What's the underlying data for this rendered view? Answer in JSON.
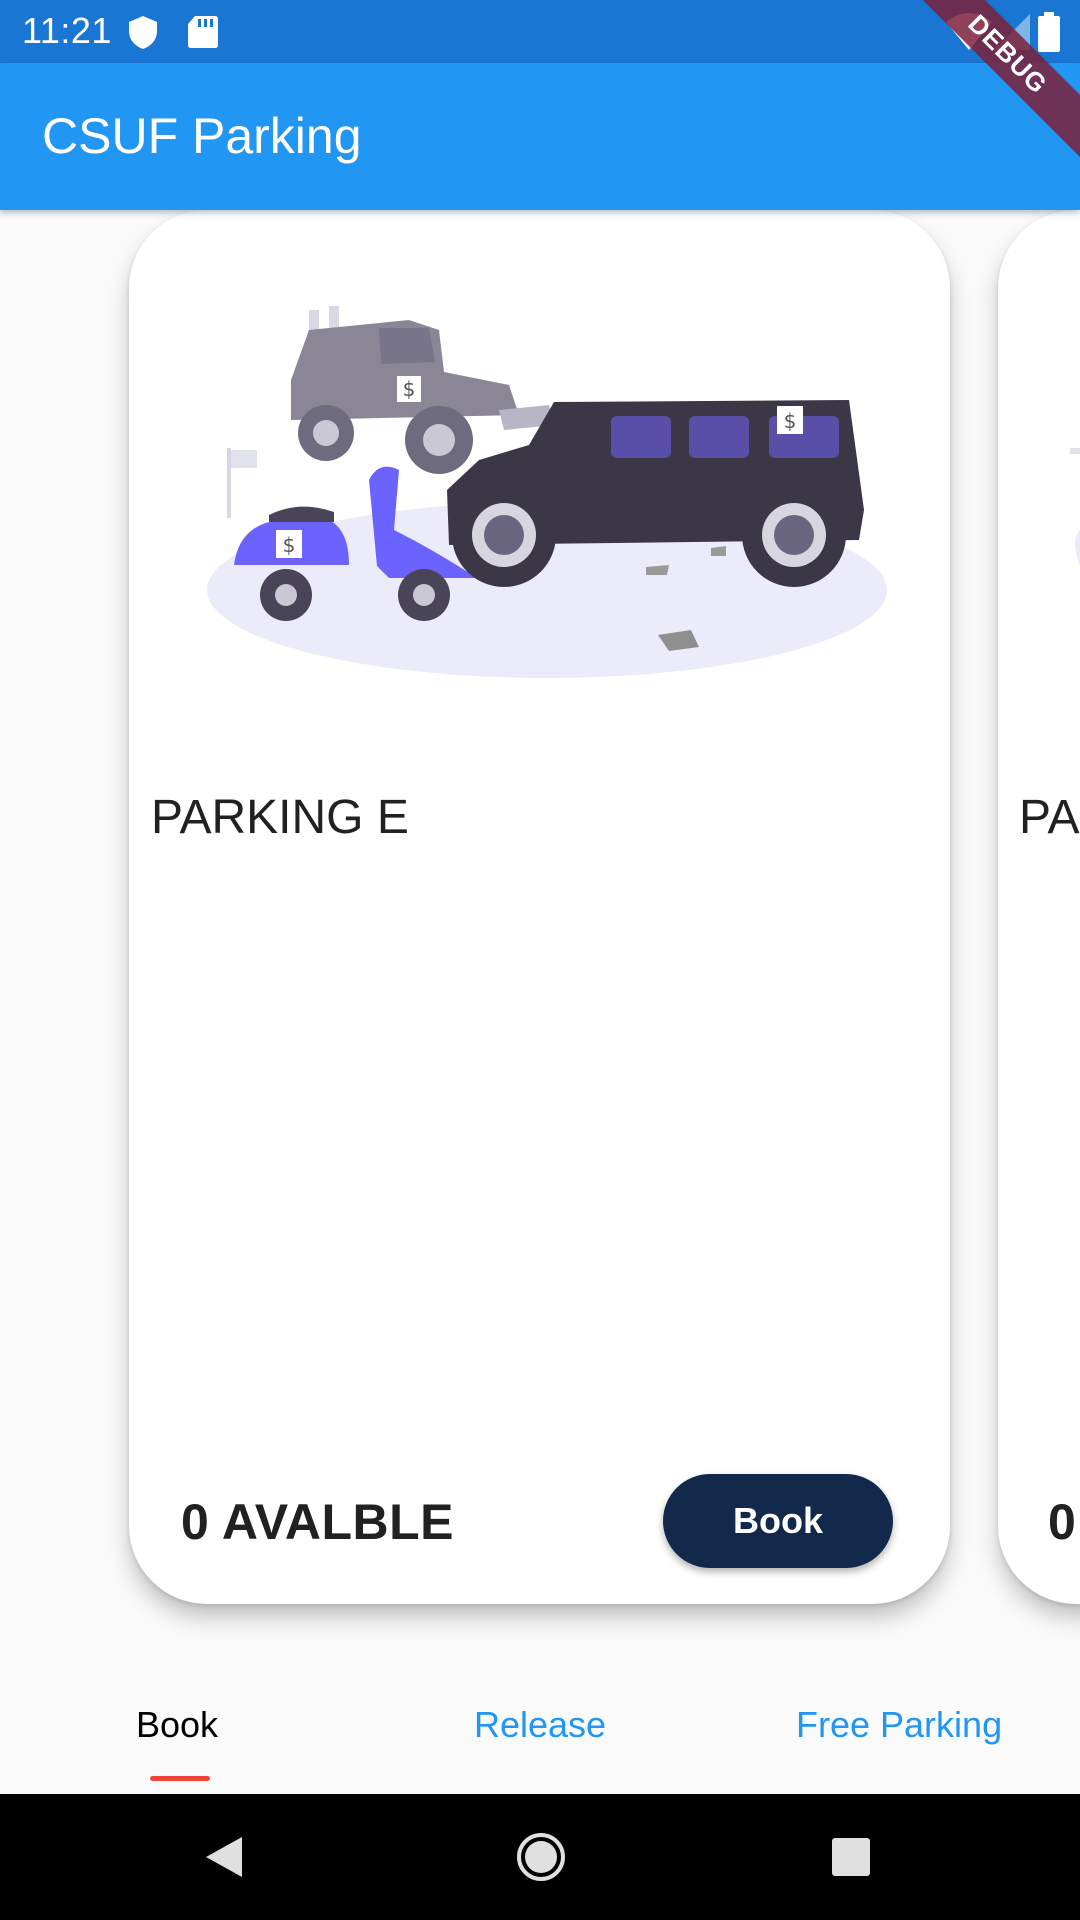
{
  "status_bar": {
    "time": "11:21",
    "icons": [
      "shield-icon",
      "sd-card-icon",
      "wifi-icon",
      "signal-icon",
      "battery-icon"
    ]
  },
  "app_bar": {
    "title": "CSUF Parking"
  },
  "debug_banner": {
    "label": "DEBUG"
  },
  "cards": [
    {
      "name": "PARKING E",
      "available_label": "0 AVALBLE",
      "book_label": "Book"
    },
    {
      "name": "PA",
      "available_label": "0"
    }
  ],
  "tabs": [
    {
      "label": "Book",
      "selected": true
    },
    {
      "label": "Release",
      "selected": false
    },
    {
      "label": "Free Parking",
      "selected": false
    }
  ],
  "nav_bar": {
    "buttons": [
      "back-icon",
      "home-icon",
      "recents-icon"
    ]
  },
  "colors": {
    "status_bar": "#1976d2",
    "app_bar": "#2196f3",
    "book_button": "#13294b",
    "tab_active_text": "#000000",
    "tab_inactive_text": "#2196f3",
    "tab_indicator": "#f44336",
    "debug_banner": "#7c213b"
  }
}
